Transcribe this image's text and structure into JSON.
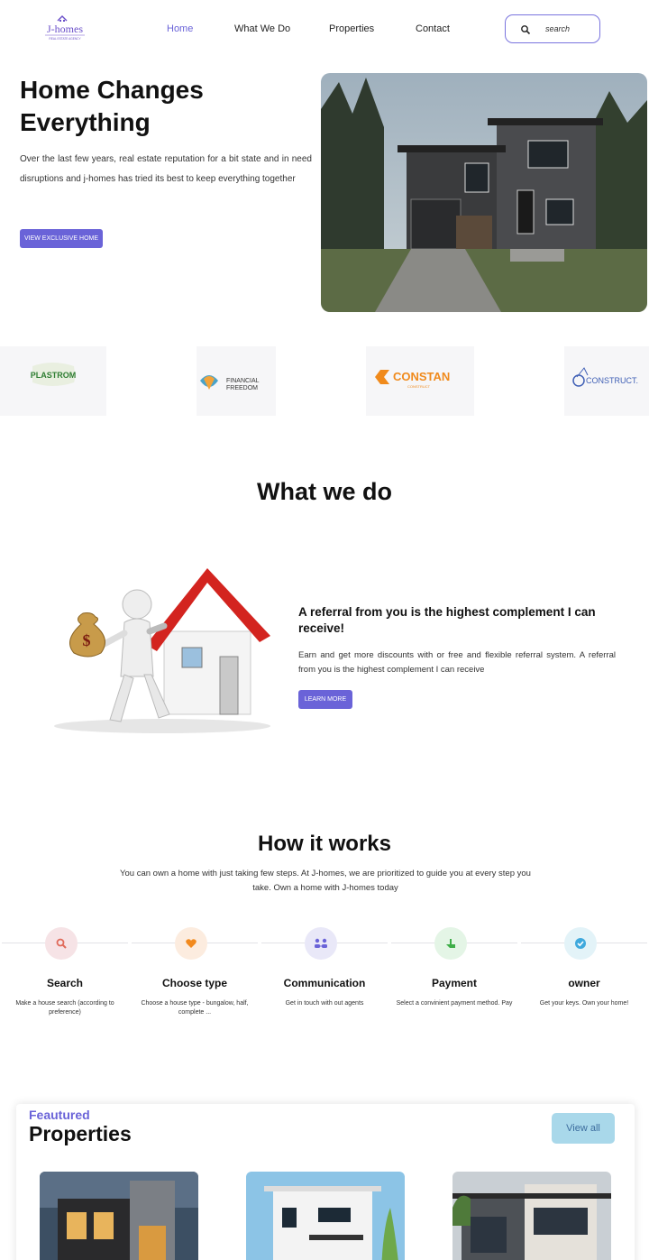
{
  "header": {
    "logo_text": "J-homes",
    "logo_tagline": "REAL ESTATE AGENCY",
    "nav": [
      "Home",
      "What We Do",
      "Properties",
      "Contact"
    ],
    "active_nav": "Home",
    "search_placeholder": "search"
  },
  "hero": {
    "title": "Home Changes Everything",
    "text": "Over the last few years, real estate reputation for a bit state and in need disruptions and j-homes has tried its best to keep everything together",
    "button": "VIEW EXCLUSIVE HOME"
  },
  "partners": {
    "logo1": "PLASTROM",
    "logo2_line1": "FINANCIAL",
    "logo2_line2": "FREEDOM",
    "logo3": "CONSTAN",
    "logo3_sub": "CONSTRUCT",
    "logo4": "CONSTRUCT."
  },
  "what_we_do": {
    "title": "What we do",
    "heading": "A referral from you is the highest complement I can receive!",
    "text": "Earn and get more discounts with or free and flexible referral system. A referral from you is the highest complement I can receive",
    "button": "LEARN MORE"
  },
  "how_it_works": {
    "title": "How it works",
    "text": "You can own a home with just taking few steps. At J-homes, we are prioritized to guide you at every step you take. Own a home with J-homes today",
    "steps": [
      {
        "title": "Search",
        "desc": "Make a house search (according to preference)",
        "icon": "search-icon",
        "color": "#f6e3e6"
      },
      {
        "title": "Choose type",
        "desc": "Choose a house type - bungalow, half, complete ...",
        "icon": "heart-icon",
        "color": "#fcecdf"
      },
      {
        "title": "Communication",
        "desc": "Get in touch with out agents",
        "icon": "people-icon",
        "color": "#e9e8f8"
      },
      {
        "title": "Payment",
        "desc": "Select a convinient payment method. Pay",
        "icon": "hand-icon",
        "color": "#e4f5e6"
      },
      {
        "title": "owner",
        "desc": "Get your keys. Own your home!",
        "icon": "check-icon",
        "color": "#e3f3f8"
      }
    ]
  },
  "featured": {
    "kicker": "Feautured",
    "title": "Properties",
    "view_all": "View all"
  },
  "colors": {
    "accent": "#6a63d8",
    "view_all_bg": "#a9d8ea"
  }
}
